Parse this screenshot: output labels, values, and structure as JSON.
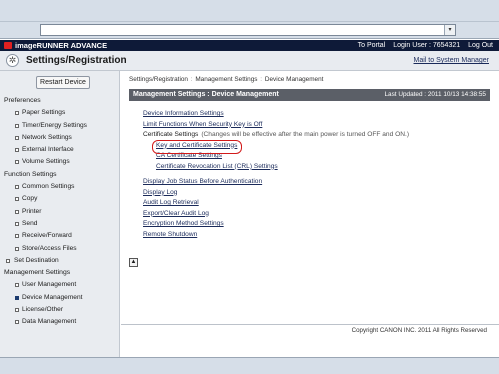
{
  "browser": {
    "address_dropdown": "▾"
  },
  "app": {
    "product": "imageRUNNER ADVANCE",
    "to_portal": "To Portal",
    "login_user": "Login User : 7654321",
    "logout": "Log Out"
  },
  "header": {
    "title": "Settings/Registration",
    "mail": "Mail to System Manager"
  },
  "sidebar": {
    "restart": "Restart Device",
    "sections": [
      {
        "label": "Preferences",
        "items": [
          "Paper Settings",
          "Timer/Energy Settings",
          "Network Settings",
          "External Interface",
          "Volume Settings"
        ]
      },
      {
        "label": "Function Settings",
        "items": [
          "Common Settings",
          "Copy",
          "Printer",
          "Send",
          "Receive/Forward",
          "Store/Access Files"
        ]
      },
      {
        "label": "Set Destination",
        "items": []
      },
      {
        "label": "Management Settings",
        "items": [
          "User Management",
          "Device Management",
          "License/Other",
          "Data Management"
        ]
      }
    ],
    "active_item": "Device Management"
  },
  "main": {
    "breadcrumb": [
      "Settings/Registration",
      "Management Settings",
      "Device Management"
    ],
    "breadcrumb_sep": ":",
    "section_title": "Management Settings : Device Management",
    "last_updated": "Last Updated : 2011 10/13 14:38:55",
    "links": [
      "Device Information Settings",
      "Limit Functions When Security Key is Off"
    ],
    "certificate_label": "Certificate Settings",
    "certificate_note": "(Changes will be effective after the main power is turned OFF and ON.)",
    "certificate_links": [
      "Key and Certificate Settings",
      "CA Certificate Settings",
      "Certificate Revocation List (CRL) Settings"
    ],
    "more_links": [
      "Display Job Status Before Authentication",
      "Display Log",
      "Audit Log Retrieval",
      "Export/Clear Audit Log",
      "Encryption Method Settings",
      "Remote Shutdown"
    ],
    "highlighted": "Key and Certificate Settings",
    "top_icon": "▲"
  },
  "footer": {
    "copyright": "Copyright CANON INC. 2011 All Rights Reserved"
  },
  "colors": {
    "app_bar": "#0e1a38",
    "section_header": "#5b5f67",
    "highlight": "#d21a1a",
    "link": "#1a2a5a"
  }
}
